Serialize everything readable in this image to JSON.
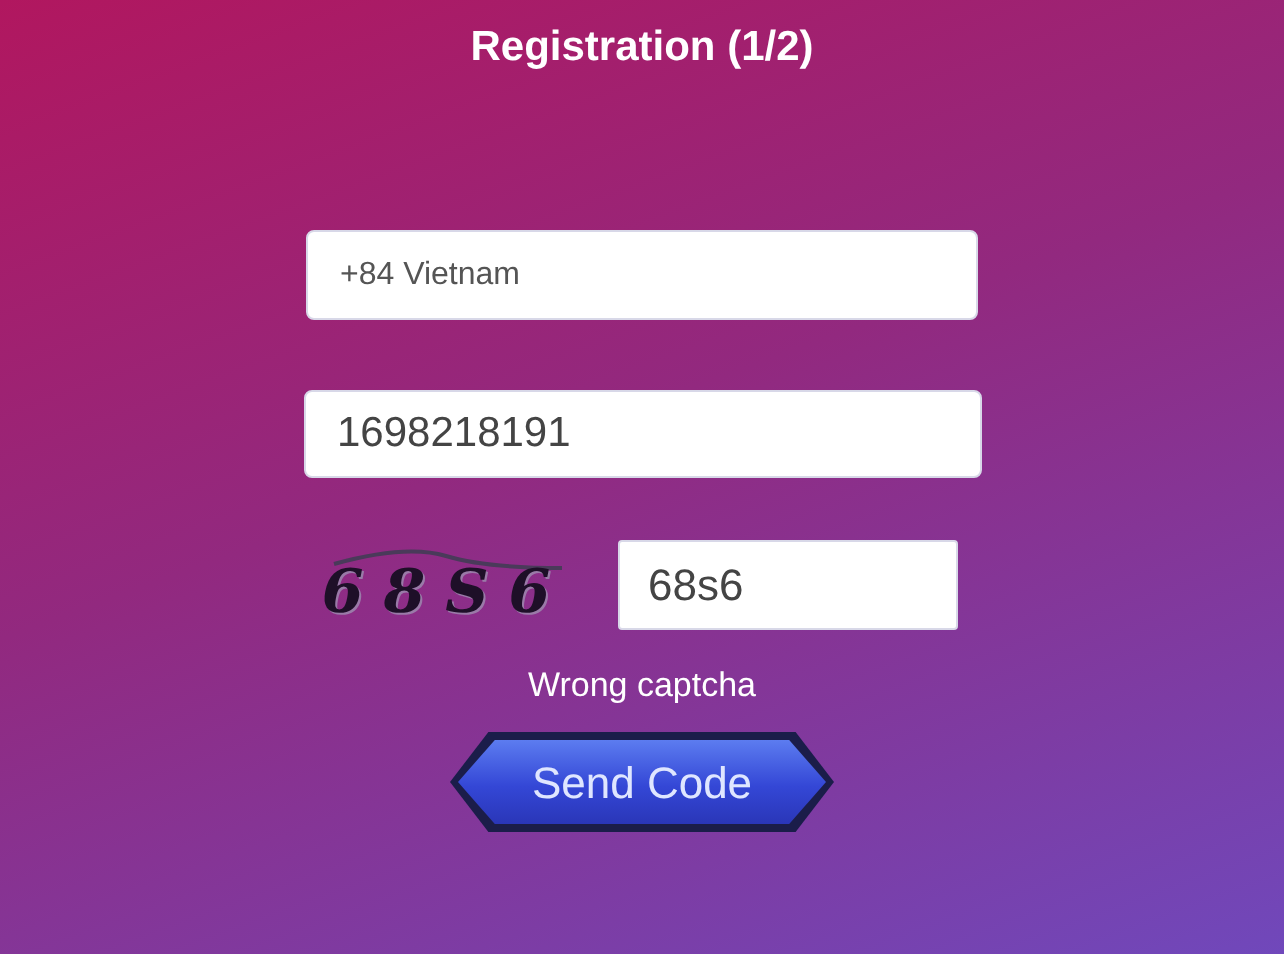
{
  "title": "Registration (1/2)",
  "country_select": {
    "value": "+84 Vietnam"
  },
  "phone_field": {
    "value": "1698218191"
  },
  "captcha": {
    "image_text": "68S6",
    "value": "68s6"
  },
  "error_message": "Wrong captcha",
  "send_button": {
    "label": "Send Code"
  }
}
